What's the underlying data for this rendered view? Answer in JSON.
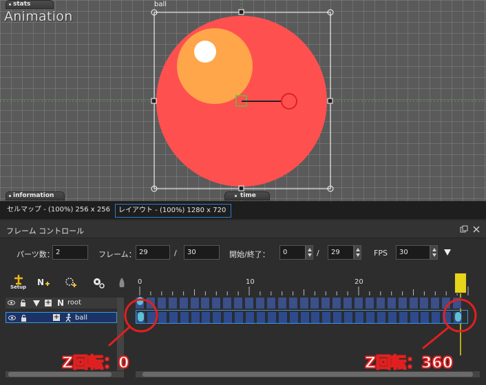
{
  "viewport": {
    "tabs": {
      "stats": "stats",
      "information": "information",
      "time": "time"
    },
    "title": "Animation",
    "selected_label": "ball",
    "colors": {
      "big_circle": "#ff5050",
      "inner_circle": "#ffa54a",
      "highlight": "#ffffff",
      "rotate_handle": "#e02020",
      "pivot": "#5fbf3f"
    }
  },
  "canvas_tabs": [
    {
      "label": "セルマップ - (100%) 256 x 256",
      "active": false
    },
    {
      "label": "レイアウト - (100%) 1280 x 720",
      "active": true
    }
  ],
  "panel": {
    "title": "フレーム コントロール",
    "fields": {
      "parts_label": "パーツ数：",
      "parts_value": "2",
      "frame_label": "フレーム：",
      "frame_current": "29",
      "frame_sep": "/",
      "frame_total": "30",
      "range_label": "開始/終了：",
      "range_start": "0",
      "range_sep": "/",
      "range_end": "29",
      "fps_label": "FPS",
      "fps_value": "30"
    },
    "toolbar": {
      "setup_label": "Setup"
    },
    "layers": [
      {
        "name": "root",
        "type": "N"
      },
      {
        "name": "ball",
        "type": "sprite"
      }
    ],
    "ruler": {
      "labels": [
        "0",
        "10",
        "20"
      ],
      "current_frame": 29,
      "frame_count": 30
    },
    "keyframes": {
      "root": [
        0
      ],
      "ball": [
        0,
        29
      ]
    },
    "annotations": {
      "left": "Z回転：0",
      "right": "Z回転：360"
    }
  }
}
